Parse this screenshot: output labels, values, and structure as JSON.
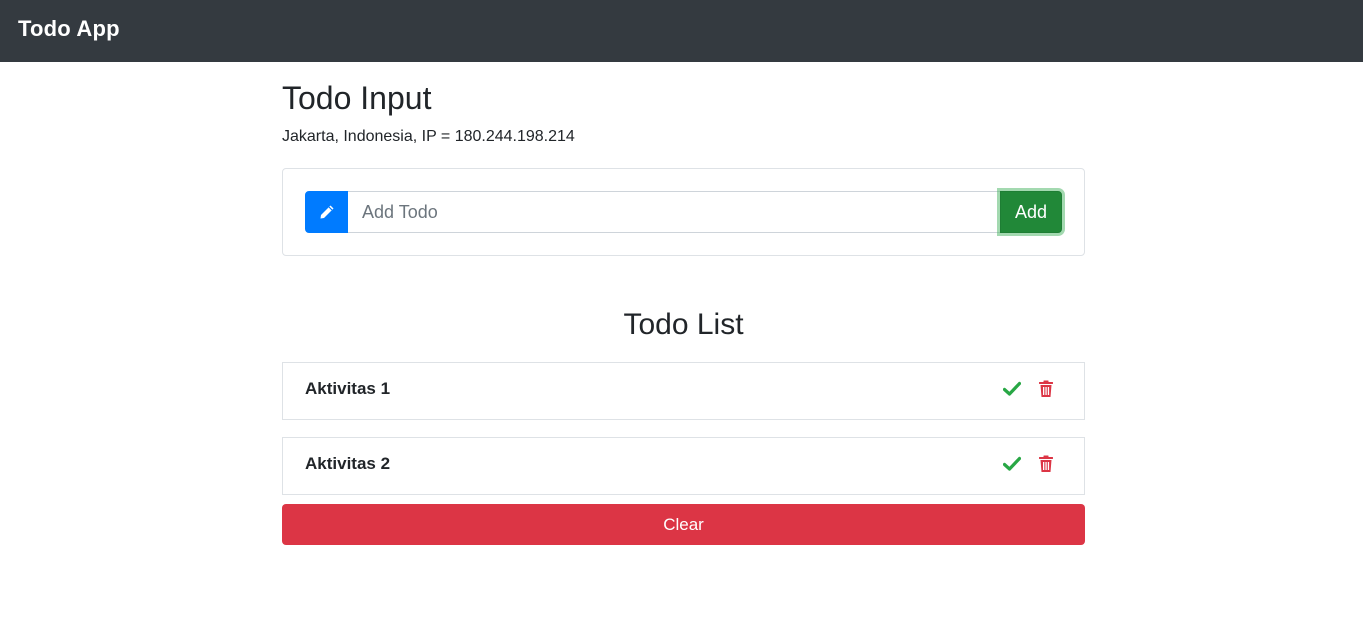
{
  "navbar": {
    "brand": "Todo App"
  },
  "input_section": {
    "title": "Todo Input",
    "location": "Jakarta, Indonesia, IP = 180.244.198.214",
    "field": {
      "placeholder": "Add Todo",
      "value": ""
    },
    "prepend_icon": "pencil-icon",
    "add_label": "Add"
  },
  "list_section": {
    "title": "Todo List",
    "items": [
      {
        "label": "Aktivitas 1",
        "done_icon": "check-icon",
        "delete_icon": "trash-icon"
      },
      {
        "label": "Aktivitas 2",
        "done_icon": "check-icon",
        "delete_icon": "trash-icon"
      }
    ],
    "clear_label": "Clear"
  },
  "colors": {
    "navbar": "#343a40",
    "primary": "#007bff",
    "success": "#28a745",
    "danger": "#dc3545"
  }
}
